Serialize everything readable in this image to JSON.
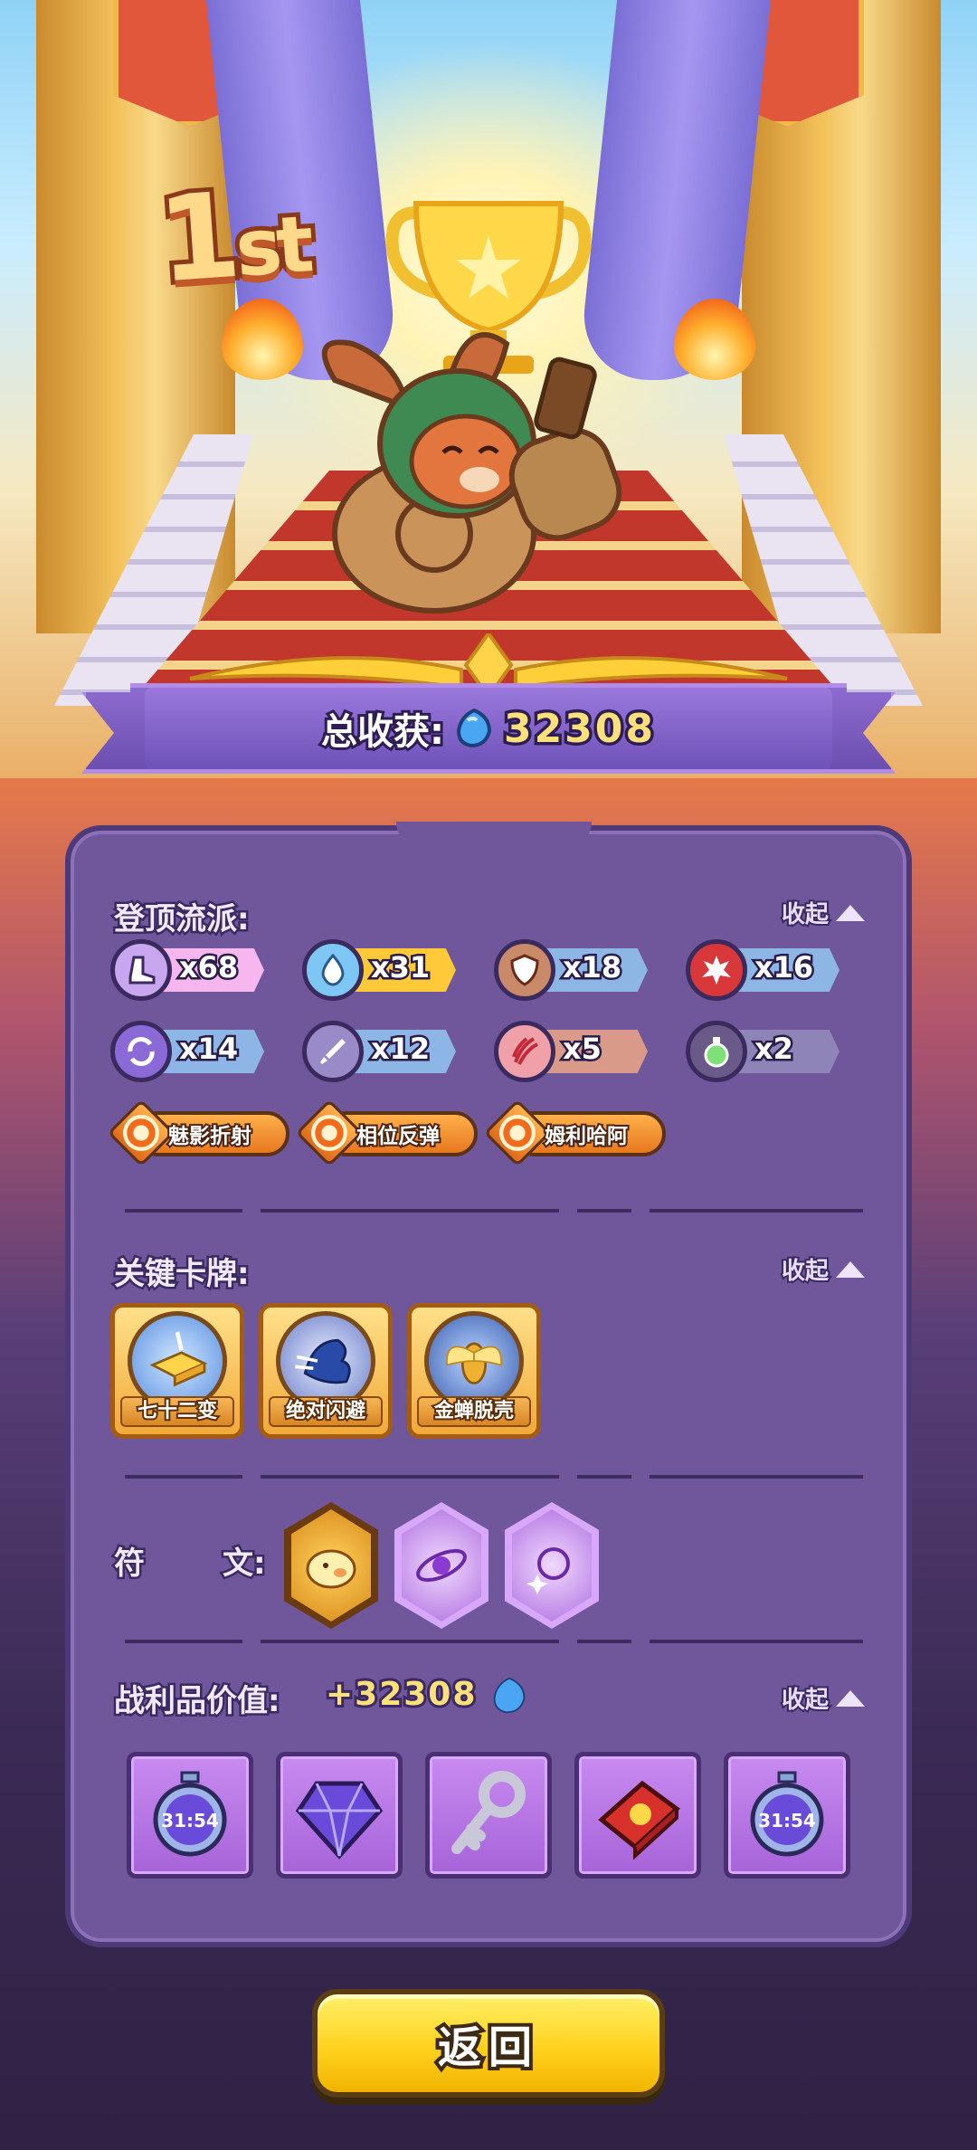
{
  "hero": {
    "rank_number": "1",
    "rank_suffix": "st"
  },
  "total_harvest": {
    "label": "总收获:",
    "value": "32308",
    "icon": "blue-gem-icon"
  },
  "sections": {
    "builds": {
      "title": "登顶流派:",
      "collapse_label": "收起",
      "stats": [
        {
          "icon": "boot-icon",
          "count": "x68",
          "color": "#f6b6ee"
        },
        {
          "icon": "water-drop-icon",
          "count": "x31",
          "color": "#ffc93a"
        },
        {
          "icon": "shield-icon",
          "count": "x18",
          "color": "#8db6e6"
        },
        {
          "icon": "explosion-icon",
          "count": "x16",
          "color": "#8db6e6"
        },
        {
          "icon": "swirl-icon",
          "count": "x14",
          "color": "#8db6e6"
        },
        {
          "icon": "sword-icon",
          "count": "x12",
          "color": "#8db6e6"
        },
        {
          "icon": "claw-icon",
          "count": "x5",
          "color": "#d99a8a"
        },
        {
          "icon": "potion-icon",
          "count": "x2",
          "color": "#8f84b8"
        }
      ],
      "genres": [
        {
          "label": "魅影折射"
        },
        {
          "label": "相位反弹"
        },
        {
          "label": "姆利哈阿"
        }
      ]
    },
    "key_cards": {
      "title": "关键卡牌:",
      "collapse_label": "收起",
      "cards": [
        {
          "name": "七十二变",
          "icon": "golden-book-icon"
        },
        {
          "name": "绝对闪避",
          "icon": "blue-dash-icon"
        },
        {
          "name": "金蝉脱壳",
          "icon": "golden-cicada-icon"
        }
      ]
    },
    "runes": {
      "label_part1": "符",
      "label_part2": "文:",
      "items": [
        {
          "icon": "golden-pig-icon"
        },
        {
          "icon": "orbit-icon"
        },
        {
          "icon": "stars-icon"
        }
      ]
    },
    "loot": {
      "title": "战利品价值:",
      "value": "+32308",
      "collapse_label": "收起",
      "items": [
        {
          "icon": "stopwatch-icon",
          "timer": "31:54"
        },
        {
          "icon": "purple-gem-icon"
        },
        {
          "icon": "key-icon"
        },
        {
          "icon": "red-book-icon"
        },
        {
          "icon": "stopwatch-icon",
          "timer": "31:54"
        }
      ]
    }
  },
  "buttons": {
    "return_label": "返回"
  }
}
